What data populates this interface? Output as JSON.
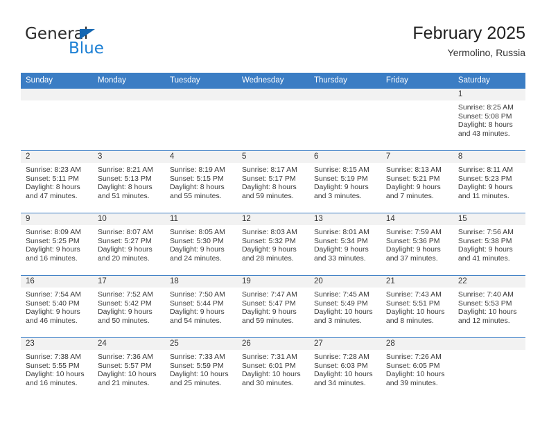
{
  "brand": {
    "name_part1": "General",
    "name_part2": "Blue",
    "triangle_color": "#1567b3",
    "blue_color": "#1b7fd4"
  },
  "header": {
    "title": "February 2025",
    "subtitle": "Yermolino, Russia"
  },
  "theme": {
    "header_blue": "#3b7dc4",
    "daynum_band": "#f2f2f2",
    "text": "#3a3a3a"
  },
  "weekday_headers": [
    "Sunday",
    "Monday",
    "Tuesday",
    "Wednesday",
    "Thursday",
    "Friday",
    "Saturday"
  ],
  "weeks": [
    [
      {
        "day": "",
        "sunrise": "",
        "sunset": "",
        "daylight1": "",
        "daylight2": ""
      },
      {
        "day": "",
        "sunrise": "",
        "sunset": "",
        "daylight1": "",
        "daylight2": ""
      },
      {
        "day": "",
        "sunrise": "",
        "sunset": "",
        "daylight1": "",
        "daylight2": ""
      },
      {
        "day": "",
        "sunrise": "",
        "sunset": "",
        "daylight1": "",
        "daylight2": ""
      },
      {
        "day": "",
        "sunrise": "",
        "sunset": "",
        "daylight1": "",
        "daylight2": ""
      },
      {
        "day": "",
        "sunrise": "",
        "sunset": "",
        "daylight1": "",
        "daylight2": ""
      },
      {
        "day": "1",
        "sunrise": "Sunrise: 8:25 AM",
        "sunset": "Sunset: 5:08 PM",
        "daylight1": "Daylight: 8 hours",
        "daylight2": "and 43 minutes."
      }
    ],
    [
      {
        "day": "2",
        "sunrise": "Sunrise: 8:23 AM",
        "sunset": "Sunset: 5:11 PM",
        "daylight1": "Daylight: 8 hours",
        "daylight2": "and 47 minutes."
      },
      {
        "day": "3",
        "sunrise": "Sunrise: 8:21 AM",
        "sunset": "Sunset: 5:13 PM",
        "daylight1": "Daylight: 8 hours",
        "daylight2": "and 51 minutes."
      },
      {
        "day": "4",
        "sunrise": "Sunrise: 8:19 AM",
        "sunset": "Sunset: 5:15 PM",
        "daylight1": "Daylight: 8 hours",
        "daylight2": "and 55 minutes."
      },
      {
        "day": "5",
        "sunrise": "Sunrise: 8:17 AM",
        "sunset": "Sunset: 5:17 PM",
        "daylight1": "Daylight: 8 hours",
        "daylight2": "and 59 minutes."
      },
      {
        "day": "6",
        "sunrise": "Sunrise: 8:15 AM",
        "sunset": "Sunset: 5:19 PM",
        "daylight1": "Daylight: 9 hours",
        "daylight2": "and 3 minutes."
      },
      {
        "day": "7",
        "sunrise": "Sunrise: 8:13 AM",
        "sunset": "Sunset: 5:21 PM",
        "daylight1": "Daylight: 9 hours",
        "daylight2": "and 7 minutes."
      },
      {
        "day": "8",
        "sunrise": "Sunrise: 8:11 AM",
        "sunset": "Sunset: 5:23 PM",
        "daylight1": "Daylight: 9 hours",
        "daylight2": "and 11 minutes."
      }
    ],
    [
      {
        "day": "9",
        "sunrise": "Sunrise: 8:09 AM",
        "sunset": "Sunset: 5:25 PM",
        "daylight1": "Daylight: 9 hours",
        "daylight2": "and 16 minutes."
      },
      {
        "day": "10",
        "sunrise": "Sunrise: 8:07 AM",
        "sunset": "Sunset: 5:27 PM",
        "daylight1": "Daylight: 9 hours",
        "daylight2": "and 20 minutes."
      },
      {
        "day": "11",
        "sunrise": "Sunrise: 8:05 AM",
        "sunset": "Sunset: 5:30 PM",
        "daylight1": "Daylight: 9 hours",
        "daylight2": "and 24 minutes."
      },
      {
        "day": "12",
        "sunrise": "Sunrise: 8:03 AM",
        "sunset": "Sunset: 5:32 PM",
        "daylight1": "Daylight: 9 hours",
        "daylight2": "and 28 minutes."
      },
      {
        "day": "13",
        "sunrise": "Sunrise: 8:01 AM",
        "sunset": "Sunset: 5:34 PM",
        "daylight1": "Daylight: 9 hours",
        "daylight2": "and 33 minutes."
      },
      {
        "day": "14",
        "sunrise": "Sunrise: 7:59 AM",
        "sunset": "Sunset: 5:36 PM",
        "daylight1": "Daylight: 9 hours",
        "daylight2": "and 37 minutes."
      },
      {
        "day": "15",
        "sunrise": "Sunrise: 7:56 AM",
        "sunset": "Sunset: 5:38 PM",
        "daylight1": "Daylight: 9 hours",
        "daylight2": "and 41 minutes."
      }
    ],
    [
      {
        "day": "16",
        "sunrise": "Sunrise: 7:54 AM",
        "sunset": "Sunset: 5:40 PM",
        "daylight1": "Daylight: 9 hours",
        "daylight2": "and 46 minutes."
      },
      {
        "day": "17",
        "sunrise": "Sunrise: 7:52 AM",
        "sunset": "Sunset: 5:42 PM",
        "daylight1": "Daylight: 9 hours",
        "daylight2": "and 50 minutes."
      },
      {
        "day": "18",
        "sunrise": "Sunrise: 7:50 AM",
        "sunset": "Sunset: 5:44 PM",
        "daylight1": "Daylight: 9 hours",
        "daylight2": "and 54 minutes."
      },
      {
        "day": "19",
        "sunrise": "Sunrise: 7:47 AM",
        "sunset": "Sunset: 5:47 PM",
        "daylight1": "Daylight: 9 hours",
        "daylight2": "and 59 minutes."
      },
      {
        "day": "20",
        "sunrise": "Sunrise: 7:45 AM",
        "sunset": "Sunset: 5:49 PM",
        "daylight1": "Daylight: 10 hours",
        "daylight2": "and 3 minutes."
      },
      {
        "day": "21",
        "sunrise": "Sunrise: 7:43 AM",
        "sunset": "Sunset: 5:51 PM",
        "daylight1": "Daylight: 10 hours",
        "daylight2": "and 8 minutes."
      },
      {
        "day": "22",
        "sunrise": "Sunrise: 7:40 AM",
        "sunset": "Sunset: 5:53 PM",
        "daylight1": "Daylight: 10 hours",
        "daylight2": "and 12 minutes."
      }
    ],
    [
      {
        "day": "23",
        "sunrise": "Sunrise: 7:38 AM",
        "sunset": "Sunset: 5:55 PM",
        "daylight1": "Daylight: 10 hours",
        "daylight2": "and 16 minutes."
      },
      {
        "day": "24",
        "sunrise": "Sunrise: 7:36 AM",
        "sunset": "Sunset: 5:57 PM",
        "daylight1": "Daylight: 10 hours",
        "daylight2": "and 21 minutes."
      },
      {
        "day": "25",
        "sunrise": "Sunrise: 7:33 AM",
        "sunset": "Sunset: 5:59 PM",
        "daylight1": "Daylight: 10 hours",
        "daylight2": "and 25 minutes."
      },
      {
        "day": "26",
        "sunrise": "Sunrise: 7:31 AM",
        "sunset": "Sunset: 6:01 PM",
        "daylight1": "Daylight: 10 hours",
        "daylight2": "and 30 minutes."
      },
      {
        "day": "27",
        "sunrise": "Sunrise: 7:28 AM",
        "sunset": "Sunset: 6:03 PM",
        "daylight1": "Daylight: 10 hours",
        "daylight2": "and 34 minutes."
      },
      {
        "day": "28",
        "sunrise": "Sunrise: 7:26 AM",
        "sunset": "Sunset: 6:05 PM",
        "daylight1": "Daylight: 10 hours",
        "daylight2": "and 39 minutes."
      },
      {
        "day": "",
        "sunrise": "",
        "sunset": "",
        "daylight1": "",
        "daylight2": ""
      }
    ]
  ]
}
